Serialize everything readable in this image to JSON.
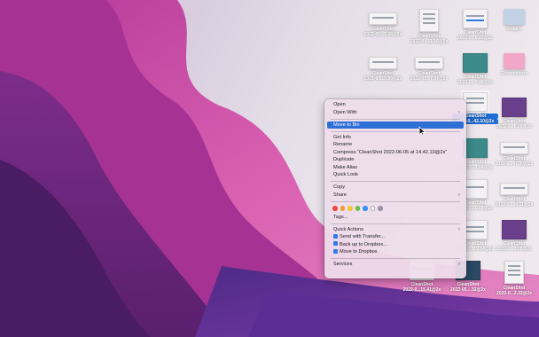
{
  "colors": {
    "accent": "#2e6fd6",
    "menu_bg": "#eedeec",
    "tag_colors": [
      "#e8493f",
      "#f29a30",
      "#f2c63a",
      "#5fbf4a",
      "#3a8df2",
      "#ffffff",
      "#a08ea8"
    ]
  },
  "desktop": {
    "icons": [
      {
        "label": "CleanShot",
        "sub": "2022-05...3.56@2x"
      },
      {
        "label": "CleanShot",
        "sub": "2022-0...11.16@2x"
      },
      {
        "label": "CleanShot",
        "sub": "2022-0...0.22@2x"
      },
      {
        "label": "Images",
        "sub": ""
      },
      {
        "label": "CleanShot",
        "sub": "2022-0...15.09@2x"
      },
      {
        "label": "CleanShot",
        "sub": "2022-05...7.37@2x"
      },
      {
        "label": "CleanShot",
        "sub": "2022-0...7.46@2x"
      },
      {
        "label": "Screenshots",
        "sub": ""
      },
      {
        "label": "CleanShot",
        "sub": "2022-0...42.10@2x"
      },
      {
        "label": "CleanShot",
        "sub": "2022-0...0.00@2x"
      },
      {
        "label": "CleanShot",
        "sub": "2022-0...1.06@2x"
      },
      {
        "label": "CleanShot",
        "sub": "2022-0...47.00@2x"
      },
      {
        "label": "CleanShot",
        "sub": "2022-0...5.09@2x"
      },
      {
        "label": "CleanShot",
        "sub": "2022-0...38.11@2x"
      },
      {
        "label": "CleanShot",
        "sub": "2022-0...19.14@2x"
      },
      {
        "label": "CleanShot",
        "sub": "2022-0...3.05@2x"
      },
      {
        "label": "CleanShot",
        "sub": "2022-0...15.41@2x"
      },
      {
        "label": "CleanShot",
        "sub": "2022-05....32@2x"
      },
      {
        "label": "CleanShot",
        "sub": "2022-0...2.33@2x"
      }
    ]
  },
  "menu": {
    "open": "Open",
    "open_with": "Open With",
    "move_to_bin": "Move to Bin",
    "get_info": "Get Info",
    "rename": "Rename",
    "compress": "Compress “CleanShot 2022-06-05 at 14.42.10@2x”",
    "duplicate": "Duplicate",
    "make_alias": "Make Alias",
    "quick_look": "Quick Look",
    "copy": "Copy",
    "share": "Share",
    "tags": "Tags...",
    "quick_actions": "Quick Actions",
    "send_with_transfer": "Send with Transfer...",
    "back_up_dropbox": "Back up to Dropbox...",
    "move_to_dropbox": "Move to Dropbox",
    "services": "Services"
  }
}
